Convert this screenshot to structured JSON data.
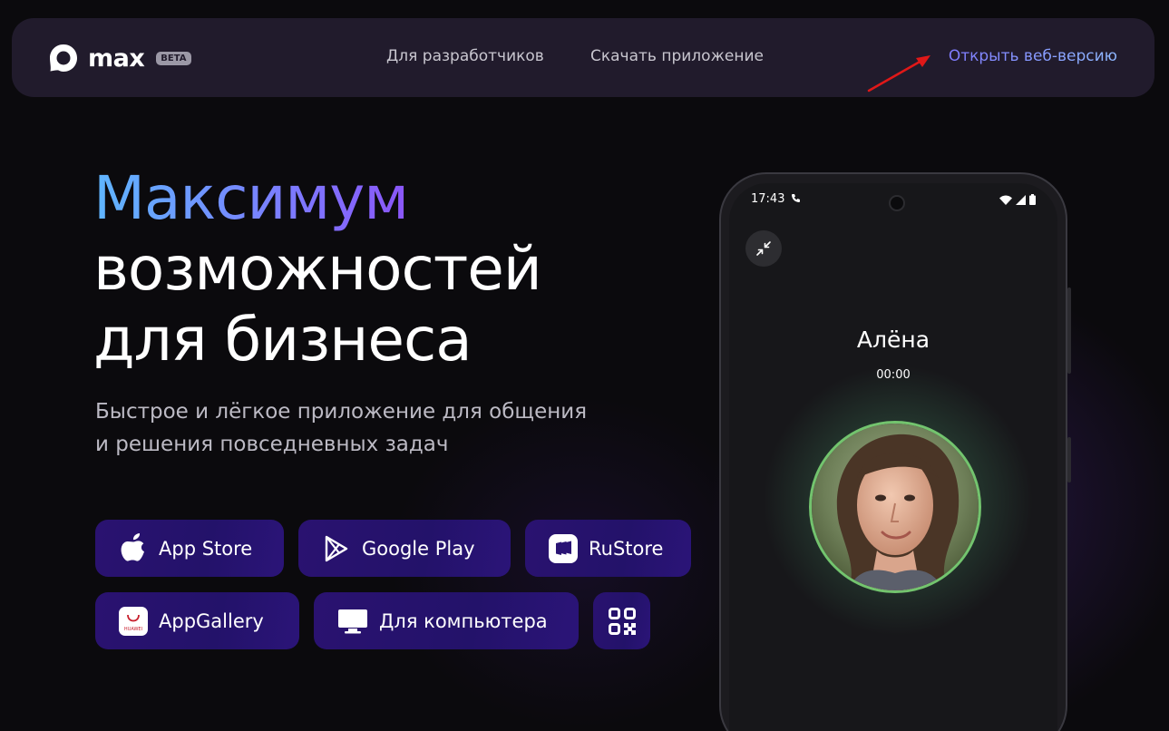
{
  "header": {
    "logo_text": "max",
    "beta_label": "BETA",
    "nav": {
      "developers": "Для разработчиков",
      "download": "Скачать приложение",
      "web_version": "Открыть веб-версию"
    }
  },
  "hero": {
    "headline_accent": "Максимум",
    "headline_line2": "возможностей",
    "headline_line3": "для бизнеса",
    "subtitle_line1": "Быстрое и лёгкое приложение для общения",
    "subtitle_line2": "и решения повседневных задач"
  },
  "stores": {
    "app_store": "App Store",
    "google_play": "Google Play",
    "rustore": "RuStore",
    "app_gallery": "AppGallery",
    "desktop": "Для компьютера",
    "huawei_mark": "HUAWEI"
  },
  "phone": {
    "status_time": "17:43",
    "caller_name": "Алёна",
    "call_timer": "00:00"
  },
  "colors": {
    "header_bg": "#211b2c",
    "button_bg": "#23126a",
    "accent_gradient_start": "#5fb6ff",
    "accent_gradient_end": "#9a2bf0",
    "web_link": "#8e83ff",
    "annotation_arrow": "#e01818",
    "avatar_ring": "#73c46e"
  },
  "icons": [
    "logo-mark-icon",
    "apple-icon",
    "google-play-icon",
    "rustore-icon",
    "huawei-icon",
    "monitor-icon",
    "qr-code-icon",
    "phone-call-icon",
    "wifi-icon",
    "signal-icon",
    "battery-icon",
    "minimize-icon"
  ]
}
